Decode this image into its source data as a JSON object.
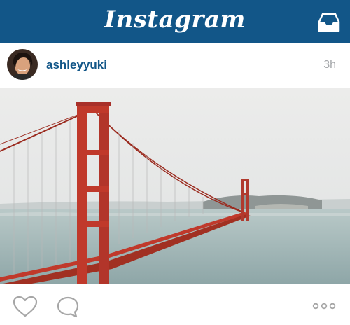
{
  "app": {
    "title": "Instagram"
  },
  "icons": {
    "inbox": "inbox-tray-icon",
    "like": "heart-icon",
    "comment": "comment-bubble-icon",
    "more": "more-dots-icon"
  },
  "post": {
    "username": "ashleyyuki",
    "time_ago": "3h",
    "image_subject": "golden-gate-bridge-photo"
  },
  "colors": {
    "brand_bar": "#125688",
    "username": "#125688",
    "timestamp": "#a5a7aa",
    "bridge": "#c0392b"
  }
}
